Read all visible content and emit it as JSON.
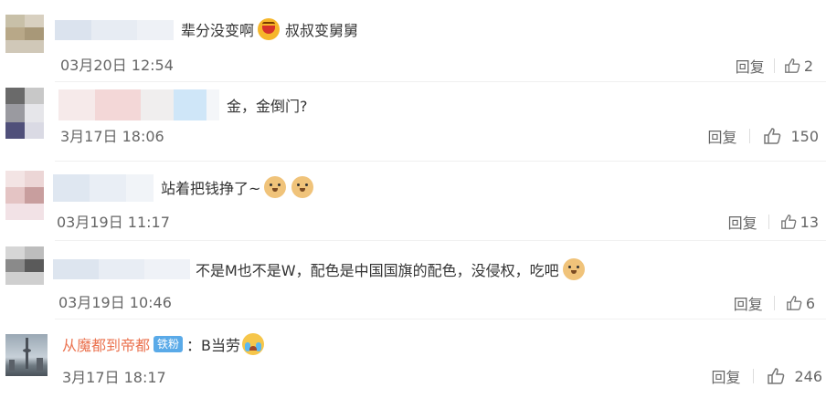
{
  "comments": [
    {
      "text": "辈分没变啊",
      "text_after": "叔叔变舅舅",
      "emoji": "laughing-emoji",
      "time": "03月20日 12:54",
      "reply_label": "回复",
      "likes": "2"
    },
    {
      "text": "金，金倒门?",
      "time": "3月17日 18:06",
      "reply_label": "回复",
      "likes": "150"
    },
    {
      "text": "站着把钱挣了~",
      "emoji": "doge-emoji",
      "time": "03月19日 11:17",
      "reply_label": "回复",
      "likes": "13"
    },
    {
      "text": "不是M也不是W，配色是中国国旗的配色，没侵权，吃吧",
      "emoji": "doge-emoji",
      "time": "03月19日 10:46",
      "reply_label": "回复",
      "likes": "6"
    },
    {
      "username": "从魔都到帝都",
      "badge": "铁粉",
      "text": "：B当劳",
      "emoji": "crying-laughing-emoji",
      "time": "3月17日 18:17",
      "reply_label": "回复",
      "likes": "246"
    }
  ],
  "colors": {
    "username": "#eb7350",
    "badge_bg": "#5aaae8",
    "meta_text": "#666666",
    "body_text": "#333333"
  }
}
